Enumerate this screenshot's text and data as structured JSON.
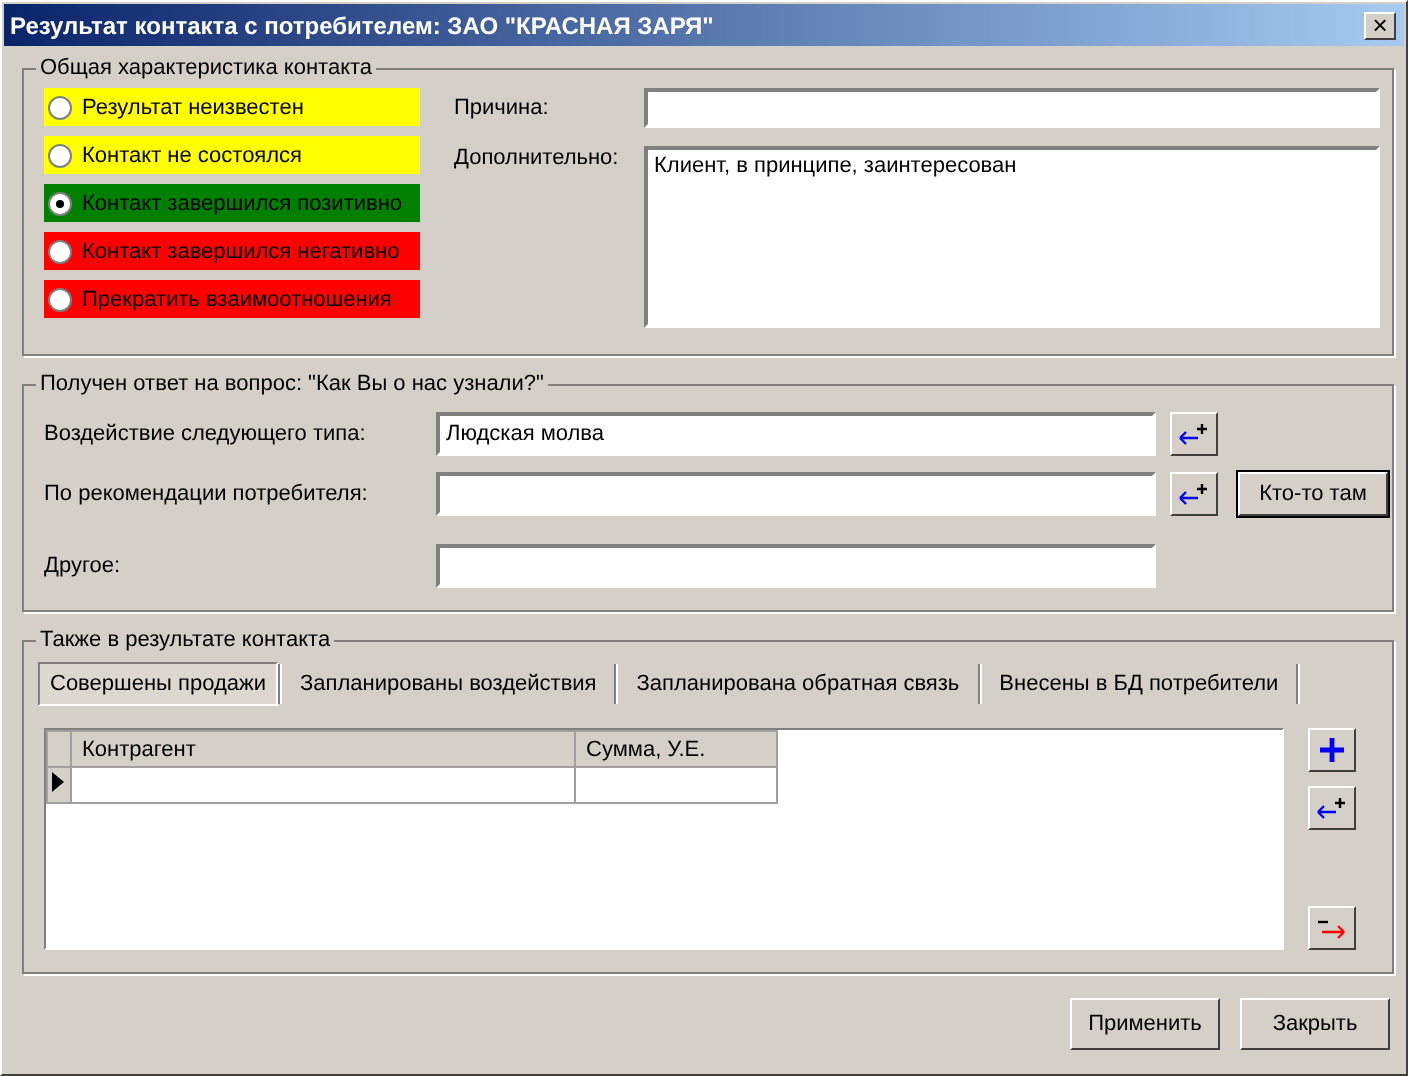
{
  "window": {
    "title": "Результат контакта с потребителем: ЗАО \"КРАСНАЯ ЗАРЯ\"",
    "close": "×"
  },
  "general": {
    "legend": "Общая характеристика контакта",
    "results": [
      {
        "label": "Результат неизвестен",
        "selected": false,
        "color": "#ffff00"
      },
      {
        "label": "Контакт не состоялся",
        "selected": false,
        "color": "#ffff00"
      },
      {
        "label": "Контакт завершился позитивно",
        "selected": true,
        "color": "#008000"
      },
      {
        "label": "Контакт завершился негативно",
        "selected": false,
        "color": "#ff0000"
      },
      {
        "label": "Прекратить взаимоотношения",
        "selected": false,
        "color": "#ff0000"
      }
    ],
    "reason": {
      "label": "Причина:"
    },
    "extra": {
      "label": "Дополнительно:",
      "value": "Клиент, в принципе, заинтересован"
    }
  },
  "source": {
    "legend": "Получен ответ на вопрос: \"Как Вы о нас узнали?\"",
    "fields": [
      {
        "label": "Воздействие следующего типа:",
        "value": "Людская молва",
        "pick": true
      },
      {
        "label": "По рекомендации потребителя:",
        "pick": true,
        "button": "Кто-то там"
      },
      {
        "label": "Другое:",
        "pick": false
      }
    ]
  },
  "also": {
    "legend": "Также в результате контакта",
    "tabs": [
      {
        "label": "Совершены продажи",
        "selected": true
      },
      {
        "label": "Запланированы воздействия",
        "selected": false
      },
      {
        "label": "Запланирована обратная связь",
        "selected": false
      },
      {
        "label": "Внесены в БД потребители",
        "selected": false
      }
    ],
    "table": {
      "columns": [
        "Контрагент",
        "Сумма, У.Е."
      ],
      "rows": [
        {
          "current": true
        }
      ]
    }
  },
  "buttons": [
    "Применить",
    "Закрыть"
  ]
}
